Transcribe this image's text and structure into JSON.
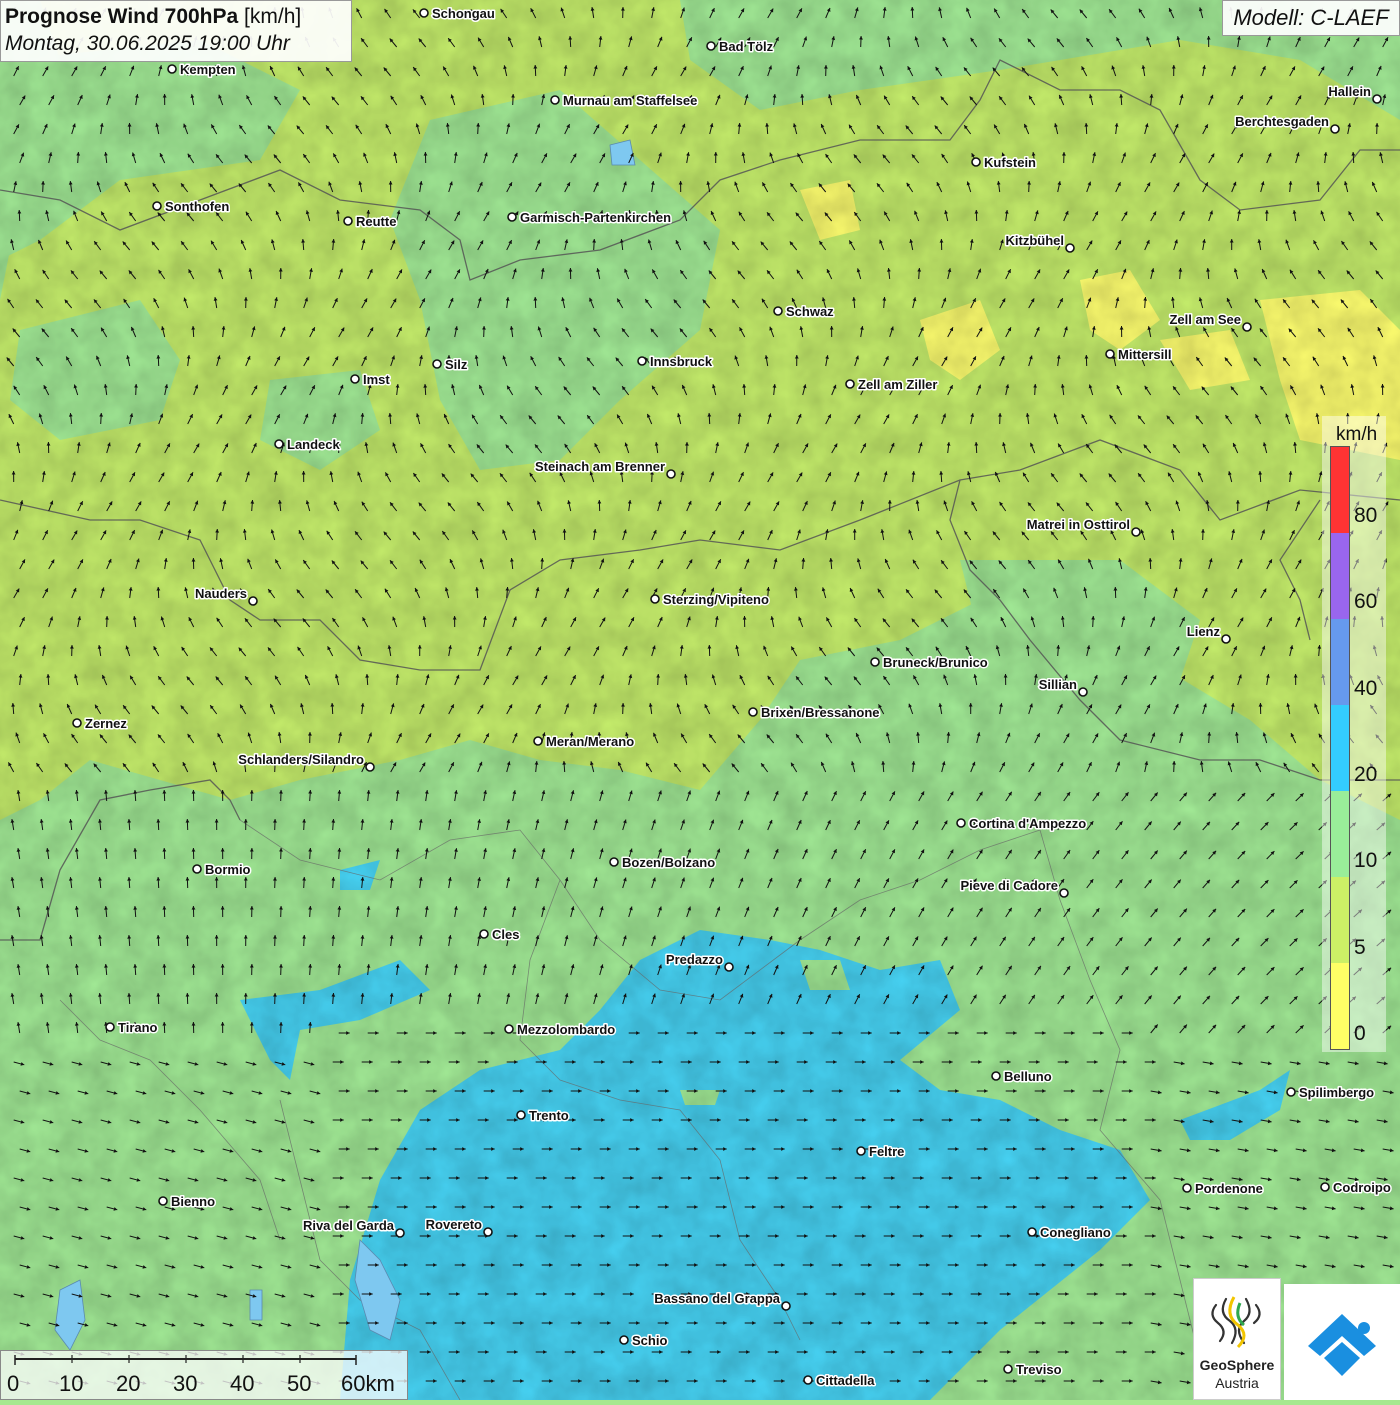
{
  "title": {
    "main": "Prognose Wind 700hPa",
    "unit": "[km/h]",
    "datetime": "Montag, 30.06.2025 19:00 Uhr"
  },
  "model": "Modell: C-LAEF",
  "legend": {
    "unit": "km/h",
    "bands": [
      {
        "from": 0,
        "to": 5,
        "color": "#ffff66"
      },
      {
        "from": 5,
        "to": 10,
        "color": "#ccf066"
      },
      {
        "from": 10,
        "to": 20,
        "color": "#99ee99"
      },
      {
        "from": 20,
        "to": 40,
        "color": "#33ccff"
      },
      {
        "from": 40,
        "to": 60,
        "color": "#6699ee"
      },
      {
        "from": 60,
        "to": 80,
        "color": "#9966ee"
      },
      {
        "from": 80,
        "to": 100,
        "color": "#ff3333"
      }
    ],
    "ticks": [
      "80",
      "60",
      "40",
      "20",
      "10",
      "5",
      "0"
    ]
  },
  "scalebar": {
    "labels": [
      "0",
      "10",
      "20",
      "30",
      "40",
      "50",
      "60km"
    ]
  },
  "logos": {
    "geosphere_line1": "GeoSphere",
    "geosphere_line2": "Austria"
  },
  "cities": [
    {
      "name": "Schongau",
      "anchor": "start"
    },
    {
      "name": "Bad Tölz",
      "anchor": "start"
    },
    {
      "name": "Kempten",
      "anchor": "start"
    },
    {
      "name": "Murnau am Staffelsee",
      "anchor": "start"
    },
    {
      "name": "Hallein",
      "anchor": "end"
    },
    {
      "name": "Berchtesgaden",
      "anchor": "end"
    },
    {
      "name": "Kufstein",
      "anchor": "start"
    },
    {
      "name": "Sonthofen",
      "anchor": "start"
    },
    {
      "name": "Reutte",
      "anchor": "start"
    },
    {
      "name": "Garmisch-Partenkirchen",
      "anchor": "start"
    },
    {
      "name": "Kitzbühel",
      "anchor": "end"
    },
    {
      "name": "Schwaz",
      "anchor": "start"
    },
    {
      "name": "Zell am See",
      "anchor": "end"
    },
    {
      "name": "Mittersill",
      "anchor": "start"
    },
    {
      "name": "Silz",
      "anchor": "start"
    },
    {
      "name": "Innsbruck",
      "anchor": "start"
    },
    {
      "name": "Imst",
      "anchor": "start"
    },
    {
      "name": "Zell am Ziller",
      "anchor": "start"
    },
    {
      "name": "Landeck",
      "anchor": "start"
    },
    {
      "name": "Steinach am Brenner",
      "anchor": "end"
    },
    {
      "name": "Matrei in Osttirol",
      "anchor": "end"
    },
    {
      "name": "Nauders",
      "anchor": "end"
    },
    {
      "name": "Sterzing/Vipiteno",
      "anchor": "start"
    },
    {
      "name": "Lienz",
      "anchor": "end"
    },
    {
      "name": "Bruneck/Brunico",
      "anchor": "start"
    },
    {
      "name": "Sillian",
      "anchor": "end"
    },
    {
      "name": "Zernez",
      "anchor": "start"
    },
    {
      "name": "Brixen/Bressanone",
      "anchor": "start"
    },
    {
      "name": "Meran/Merano",
      "anchor": "start"
    },
    {
      "name": "Schlanders/Silandro",
      "anchor": "end"
    },
    {
      "name": "Cortina d'Ampezzo",
      "anchor": "start"
    },
    {
      "name": "Bozen/Bolzano",
      "anchor": "start"
    },
    {
      "name": "Bormio",
      "anchor": "start"
    },
    {
      "name": "Pieve di Cadore",
      "anchor": "end"
    },
    {
      "name": "Cles",
      "anchor": "start"
    },
    {
      "name": "Predazzo",
      "anchor": "end"
    },
    {
      "name": "Tirano",
      "anchor": "start"
    },
    {
      "name": "Mezzolombardo",
      "anchor": "start"
    },
    {
      "name": "Belluno",
      "anchor": "start"
    },
    {
      "name": "Spilimbergo",
      "anchor": "start"
    },
    {
      "name": "Trento",
      "anchor": "start"
    },
    {
      "name": "Feltre",
      "anchor": "start"
    },
    {
      "name": "Pordenone",
      "anchor": "start"
    },
    {
      "name": "Codroipo",
      "anchor": "start"
    },
    {
      "name": "Bienno",
      "anchor": "start"
    },
    {
      "name": "Riva del Garda",
      "anchor": "end"
    },
    {
      "name": "Rovereto",
      "anchor": "end"
    },
    {
      "name": "Conegliano",
      "anchor": "start"
    },
    {
      "name": "Bassano del Grappa",
      "anchor": "end"
    },
    {
      "name": "Schio",
      "anchor": "start"
    },
    {
      "name": "Cittadella",
      "anchor": "start"
    },
    {
      "name": "Treviso",
      "anchor": "start"
    }
  ]
}
